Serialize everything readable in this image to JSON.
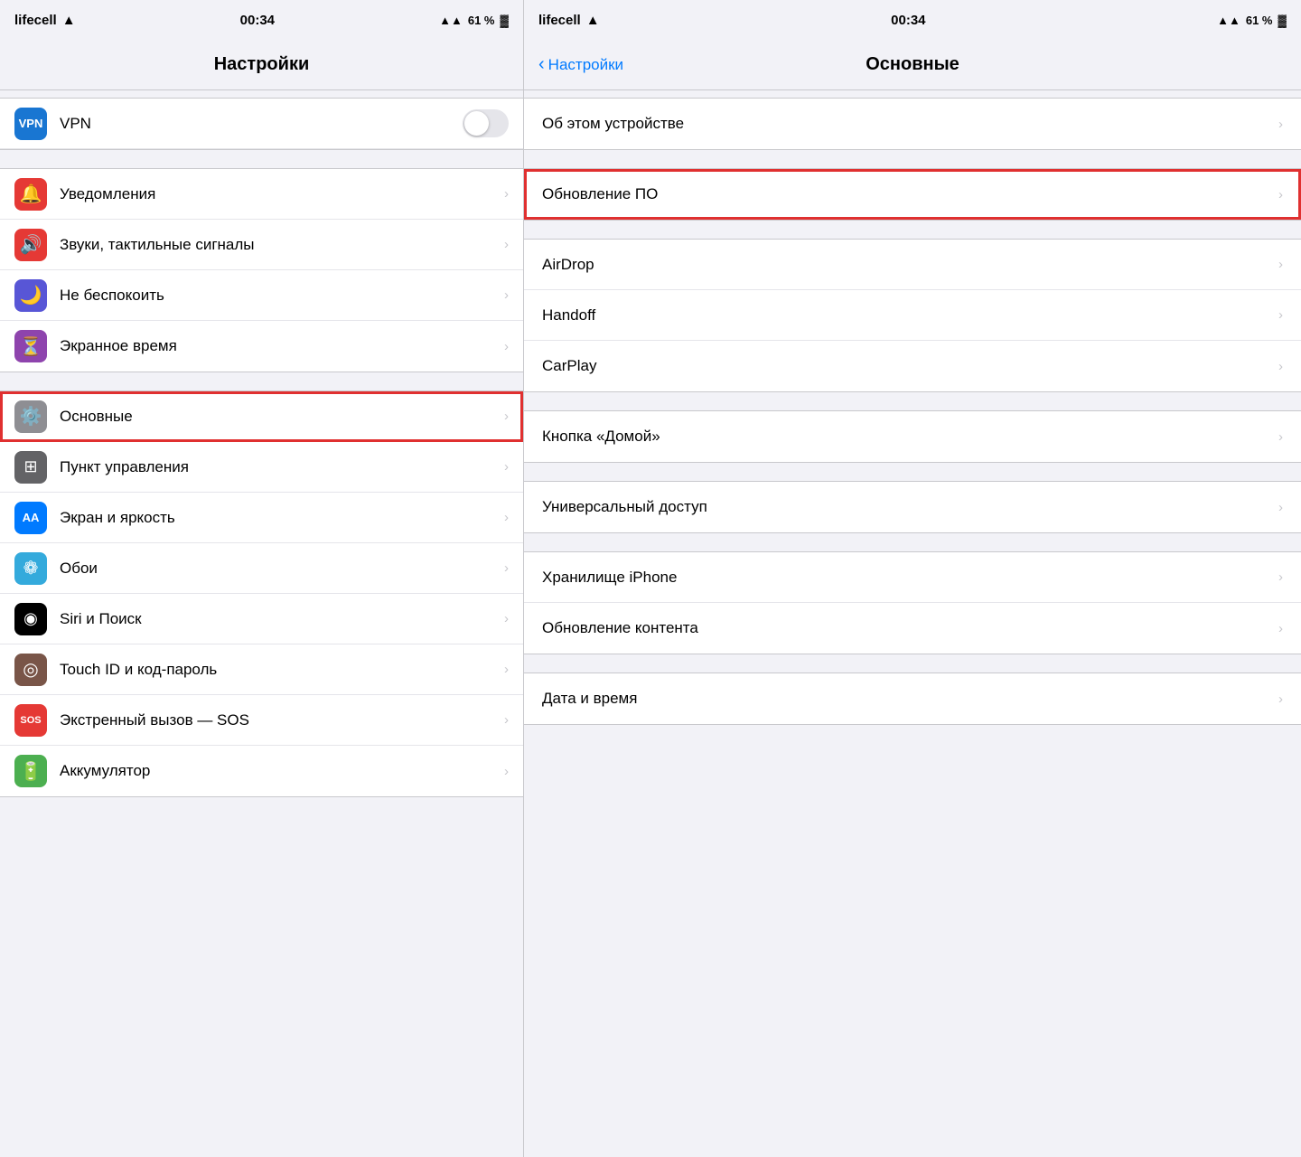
{
  "left": {
    "status_bar": {
      "carrier": "lifecell",
      "wifi": "wifi",
      "time": "00:34",
      "battery": "61 %"
    },
    "nav_title": "Настройки",
    "vpn_label": "VPN",
    "sections": [
      {
        "id": "section-notifications",
        "rows": [
          {
            "id": "notifications",
            "icon_bg": "bg-red",
            "icon": "🔔",
            "label": "Уведомления",
            "chevron": true
          },
          {
            "id": "sounds",
            "icon_bg": "bg-red",
            "icon": "🔊",
            "label": "Звуки, тактильные сигналы",
            "chevron": true
          },
          {
            "id": "donotdisturb",
            "icon_bg": "bg-indigo",
            "icon": "🌙",
            "label": "Не беспокоить",
            "chevron": true
          },
          {
            "id": "screentime",
            "icon_bg": "bg-purple",
            "icon": "⏳",
            "label": "Экранное время",
            "chevron": true
          }
        ]
      },
      {
        "id": "section-general",
        "rows": [
          {
            "id": "general",
            "icon_bg": "bg-gray",
            "icon": "⚙️",
            "label": "Основные",
            "chevron": true,
            "highlighted": true
          },
          {
            "id": "controlcenter",
            "icon_bg": "bg-gray2",
            "icon": "⊞",
            "label": "Пункт управления",
            "chevron": true
          },
          {
            "id": "display",
            "icon_bg": "bg-blue",
            "icon": "AA",
            "label": "Экран и яркость",
            "chevron": true
          },
          {
            "id": "wallpaper",
            "icon_bg": "bg-cyan",
            "icon": "❁",
            "label": "Обои",
            "chevron": true
          },
          {
            "id": "siri",
            "icon_bg": "bg-siri",
            "icon": "◉",
            "label": "Siri и Поиск",
            "chevron": true
          },
          {
            "id": "touchid",
            "icon_bg": "bg-touch",
            "icon": "◎",
            "label": "Touch ID и код-пароль",
            "chevron": true
          },
          {
            "id": "sos",
            "icon_bg": "bg-sos",
            "icon": "SOS",
            "label": "Экстренный вызов — SOS",
            "chevron": true
          },
          {
            "id": "battery",
            "icon_bg": "bg-battery",
            "icon": "🔋",
            "label": "Аккумулятор",
            "chevron": true
          }
        ]
      }
    ]
  },
  "right": {
    "status_bar": {
      "carrier": "lifecell",
      "wifi": "wifi",
      "time": "00:34",
      "battery": "61 %"
    },
    "nav_back_label": "Настройки",
    "nav_title": "Основные",
    "sections": [
      {
        "id": "right-section-1",
        "rows": [
          {
            "id": "about",
            "label": "Об этом устройстве",
            "chevron": true
          }
        ]
      },
      {
        "id": "right-section-2",
        "rows": [
          {
            "id": "software-update",
            "label": "Обновление ПО",
            "chevron": true,
            "highlighted": true
          }
        ]
      },
      {
        "id": "right-section-3",
        "rows": [
          {
            "id": "airdrop",
            "label": "AirDrop",
            "chevron": true
          },
          {
            "id": "handoff",
            "label": "Handoff",
            "chevron": true
          },
          {
            "id": "carplay",
            "label": "CarPlay",
            "chevron": true
          }
        ]
      },
      {
        "id": "right-section-4",
        "rows": [
          {
            "id": "home-button",
            "label": "Кнопка «Домой»",
            "chevron": true
          }
        ]
      },
      {
        "id": "right-section-5",
        "rows": [
          {
            "id": "accessibility",
            "label": "Универсальный доступ",
            "chevron": true
          }
        ]
      },
      {
        "id": "right-section-6",
        "rows": [
          {
            "id": "iphone-storage",
            "label": "Хранилище iPhone",
            "chevron": true
          },
          {
            "id": "content-refresh",
            "label": "Обновление контента",
            "chevron": true
          }
        ]
      },
      {
        "id": "right-section-7",
        "rows": [
          {
            "id": "date-time",
            "label": "Дата и время",
            "chevron": true
          }
        ]
      }
    ],
    "chevron_label": "›"
  }
}
